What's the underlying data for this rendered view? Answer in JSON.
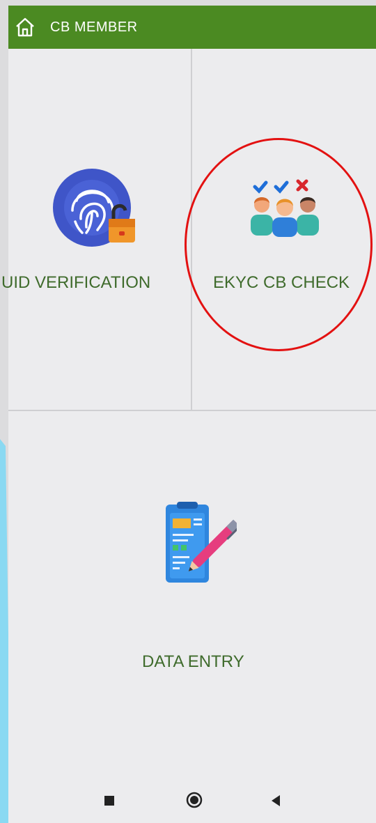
{
  "header": {
    "title": "CB MEMBER",
    "home_icon": "home-icon"
  },
  "tiles": [
    {
      "label": "UID VERIFICATION",
      "icon": "fingerprint-lock-icon"
    },
    {
      "label": "EKYC CB CHECK",
      "icon": "people-check-icon"
    },
    {
      "label": "DATA ENTRY",
      "icon": "document-pen-icon"
    }
  ],
  "highlight": {
    "target": "EKYC CB CHECK",
    "color": "#e31111"
  },
  "colors": {
    "header_bg": "#4b8a22",
    "label": "#3f6b2c"
  },
  "navbar": {
    "buttons": [
      "recents-icon",
      "home-circle-icon",
      "back-icon"
    ]
  }
}
